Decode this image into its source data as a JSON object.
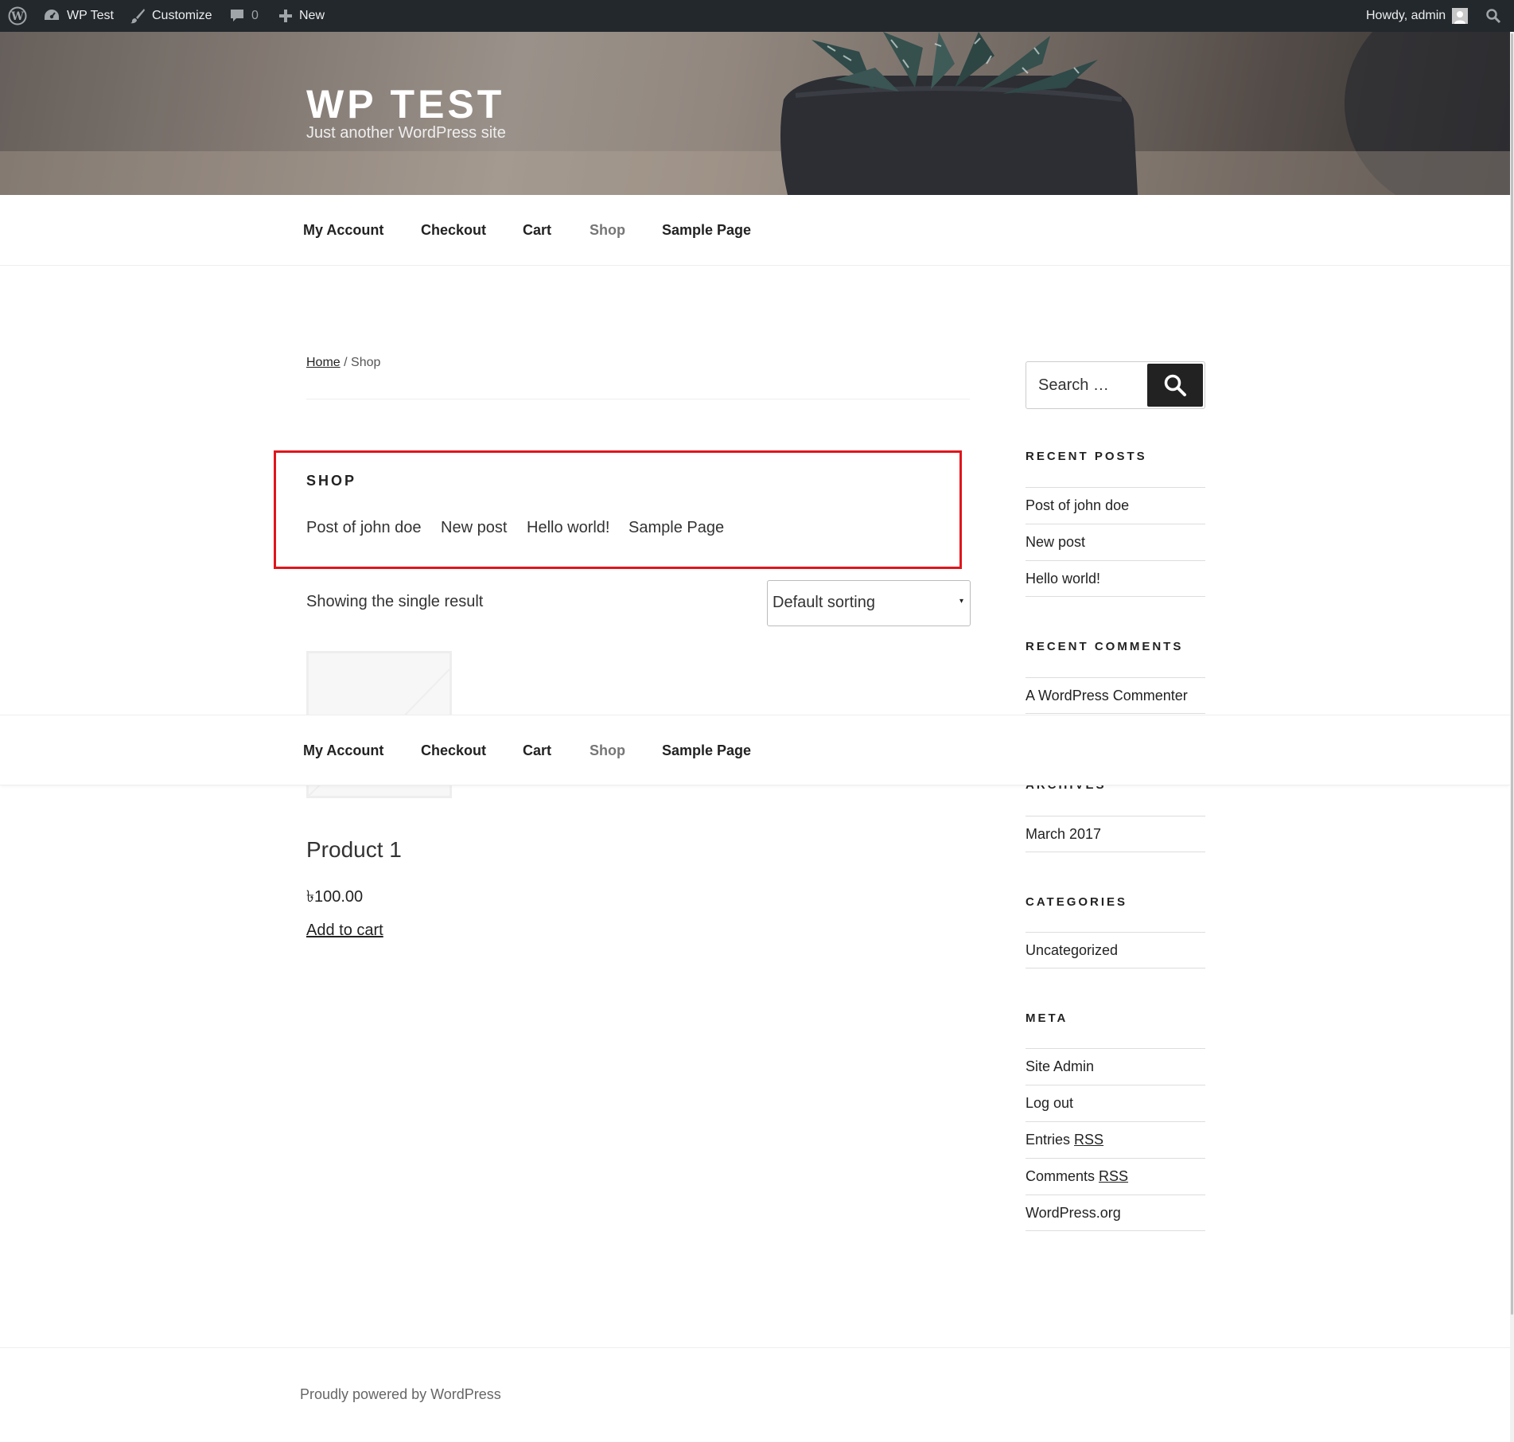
{
  "admin_bar": {
    "site_name": "WP Test",
    "customize": "Customize",
    "comments_count": "0",
    "new_label": "New",
    "howdy": "Howdy, admin",
    "bg_color": "#23282d"
  },
  "header": {
    "site_title": "WP TEST",
    "site_description": "Just another WordPress site"
  },
  "nav": {
    "items": [
      "My Account",
      "Checkout",
      "Cart",
      "Shop",
      "Sample Page"
    ],
    "current": "Shop"
  },
  "breadcrumb": {
    "home": "Home",
    "separator": " / ",
    "current": "Shop"
  },
  "shop": {
    "title": "SHOP",
    "page_links": [
      "Post of john doe",
      "New post",
      "Hello world!",
      "Sample Page"
    ],
    "highlight_color": "#e0151c"
  },
  "catalog": {
    "result_count": "Showing the single result",
    "sort_value": "Default sorting",
    "sort_arrow": "▾"
  },
  "product": {
    "name": "Product 1",
    "price": "৳100.00",
    "add_to_cart": "Add to cart"
  },
  "sidebar": {
    "search_placeholder": "Search …",
    "recent_posts": {
      "title": "RECENT POSTS",
      "items": [
        "Post of john doe",
        "New post",
        "Hello world!"
      ]
    },
    "recent_comments": {
      "title": "RECENT COMMENTS",
      "items": [
        "A WordPress Commenter"
      ]
    },
    "archives": {
      "title": "ARCHIVES",
      "items": [
        "March 2017"
      ]
    },
    "categories": {
      "title": "CATEGORIES",
      "items": [
        "Uncategorized"
      ]
    },
    "meta": {
      "title": "META",
      "items": [
        "Site Admin",
        "Log out",
        "Entries",
        "Comments",
        "WordPress.org"
      ],
      "rss": "RSS"
    }
  },
  "footer": {
    "text": "Proudly powered by WordPress"
  }
}
